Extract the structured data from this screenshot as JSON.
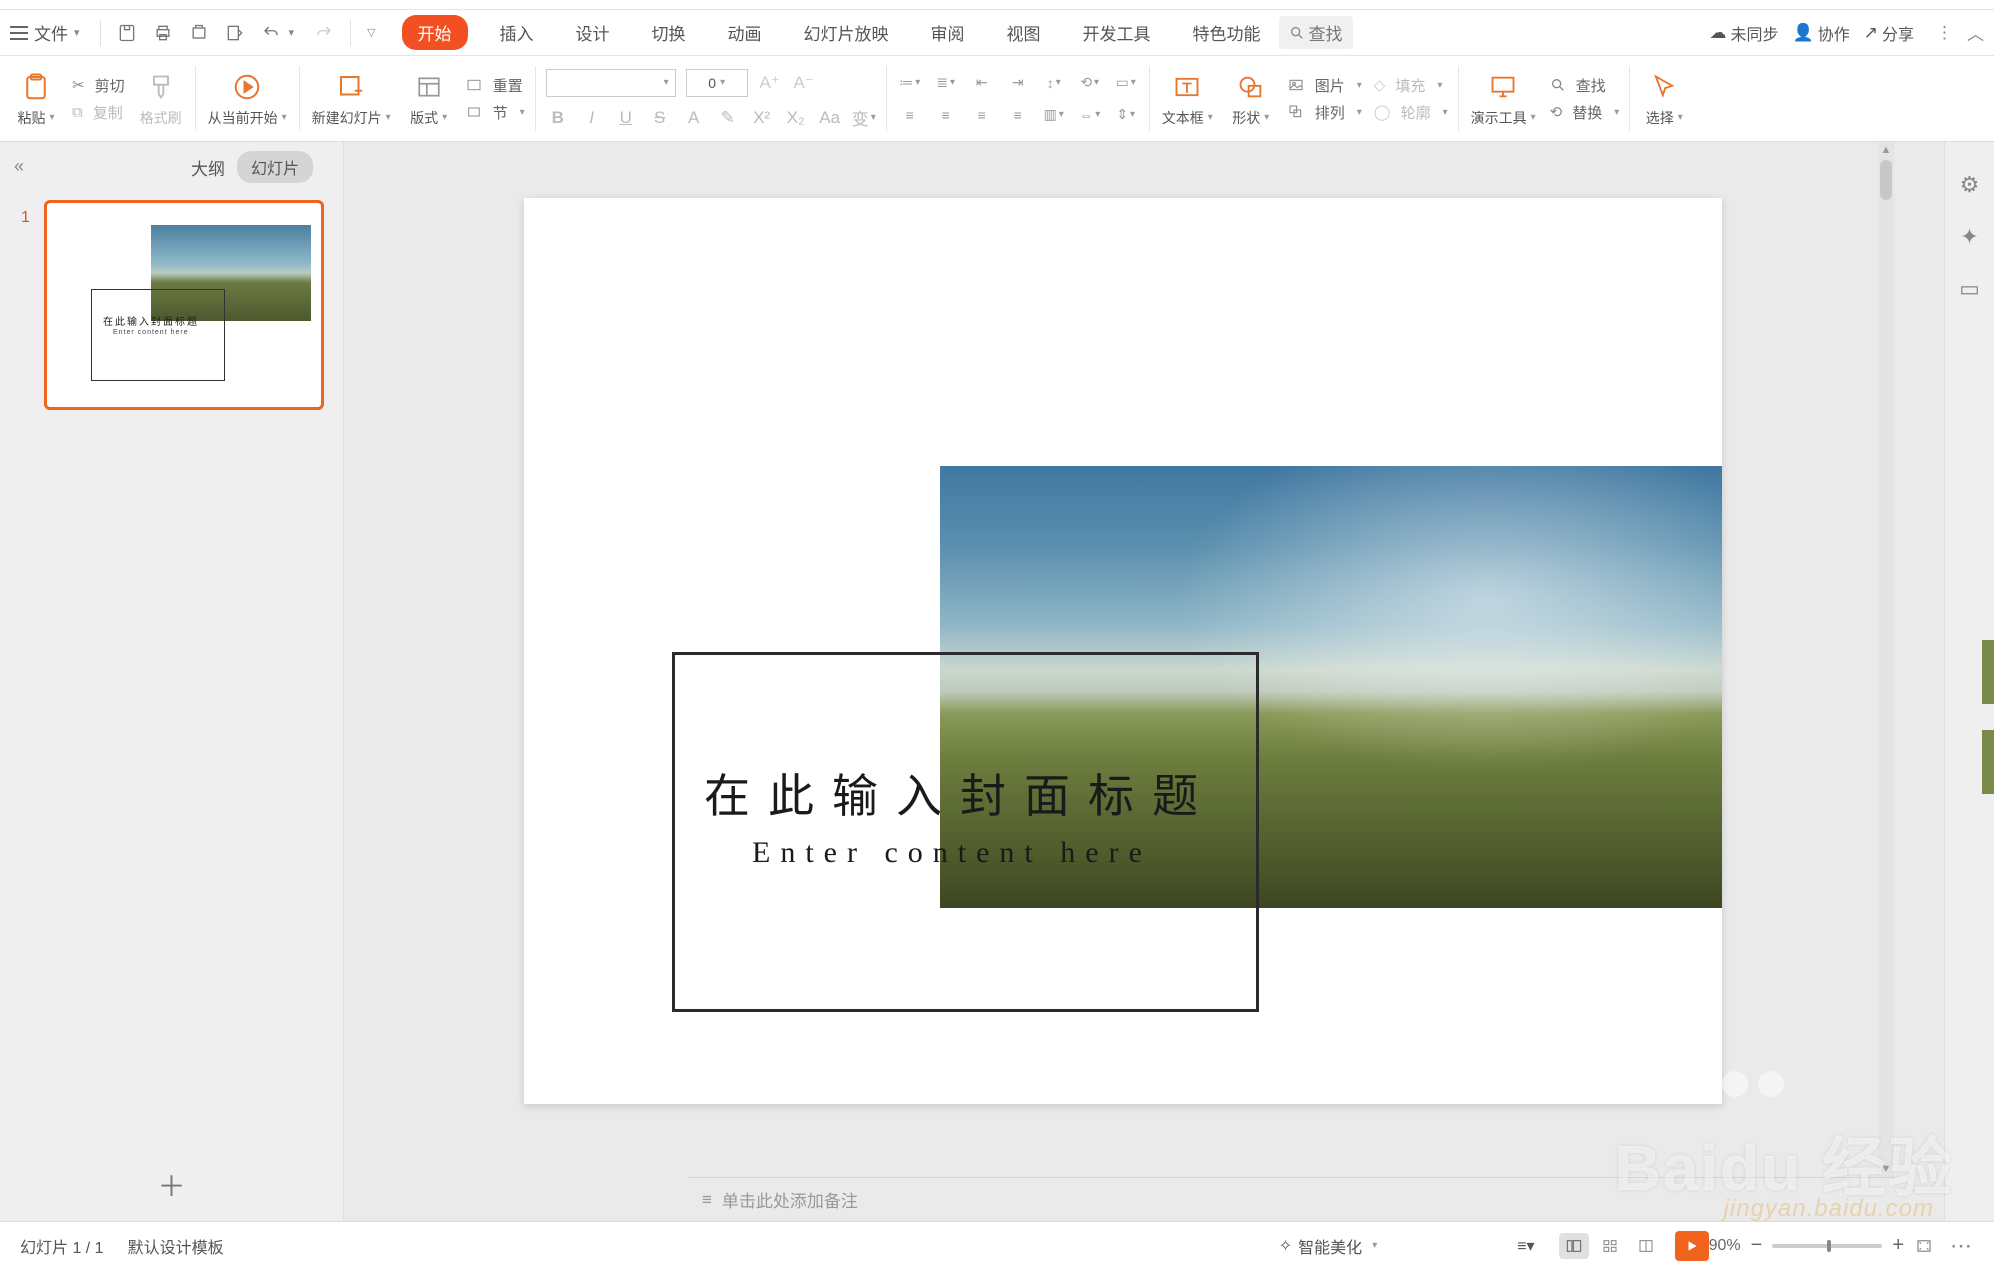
{
  "menu": {
    "file": "文件",
    "tabs": [
      "开始",
      "插入",
      "设计",
      "切换",
      "动画",
      "幻灯片放映",
      "审阅",
      "视图",
      "开发工具",
      "特色功能"
    ],
    "active_tab": 0,
    "search": "查找",
    "sync": "未同步",
    "coop": "协作",
    "share": "分享"
  },
  "ribbon": {
    "paste": "粘贴",
    "cut": "剪切",
    "copy": "复制",
    "format_painter": "格式刷",
    "from_current": "从当前开始",
    "new_slide": "新建幻灯片",
    "layout": "版式",
    "section": "节",
    "reset": "重置",
    "font_name": "",
    "font_size": "0",
    "textbox": "文本框",
    "shape": "形状",
    "picture": "图片",
    "arrange": "排列",
    "fill": "填充",
    "outline": "轮廓",
    "present_tools": "演示工具",
    "find": "查找",
    "replace": "替换",
    "select": "选择"
  },
  "thumbs": {
    "outline": "大纲",
    "slides": "幻灯片",
    "num1": "1"
  },
  "slide": {
    "title": "在此输入封面标题",
    "subtitle": "Enter content here"
  },
  "notes": {
    "placeholder": "单击此处添加备注"
  },
  "status": {
    "page": "幻灯片 1 / 1",
    "template": "默认设计模板",
    "beautify": "智能美化",
    "zoom": "90%"
  },
  "watermark": {
    "brand": "Baidu 经验",
    "url": "jingyan.baidu.com"
  }
}
